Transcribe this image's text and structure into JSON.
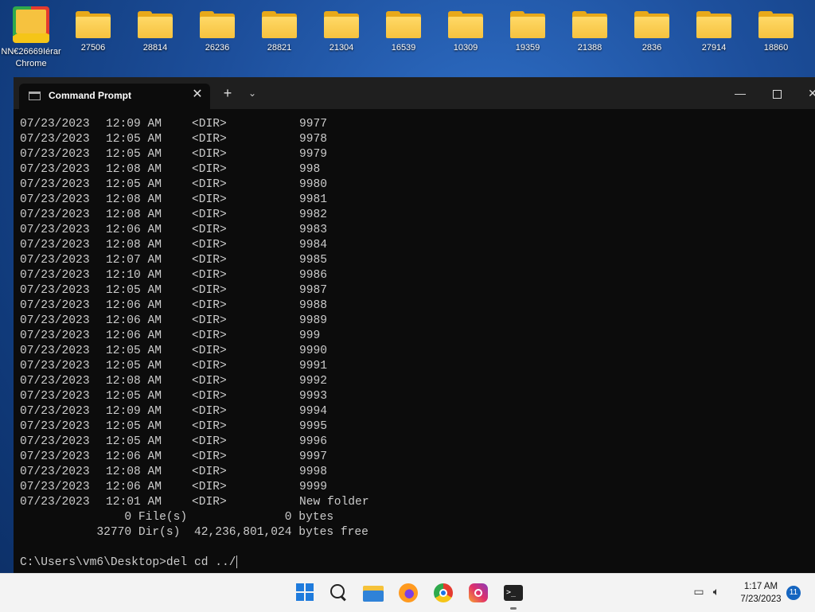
{
  "desktop": {
    "chrome_shortcut": {
      "label_line1": "NN€26669Iérar",
      "label_line2": "Chrome"
    },
    "folders": [
      "27506",
      "28814",
      "26236",
      "28821",
      "21304",
      "16539",
      "10309",
      "19359",
      "21388",
      "2836",
      "27914",
      "18860"
    ]
  },
  "window": {
    "tab_title": "Command Prompt",
    "tab_close": "✕",
    "new_tab": "+",
    "tab_dropdown": "⌄",
    "minimize": "—",
    "close": "✕"
  },
  "console": {
    "rows": [
      {
        "date": "07/23/2023",
        "time": "12:09 AM",
        "type": "<DIR>",
        "name": "9977"
      },
      {
        "date": "07/23/2023",
        "time": "12:05 AM",
        "type": "<DIR>",
        "name": "9978"
      },
      {
        "date": "07/23/2023",
        "time": "12:05 AM",
        "type": "<DIR>",
        "name": "9979"
      },
      {
        "date": "07/23/2023",
        "time": "12:08 AM",
        "type": "<DIR>",
        "name": "998"
      },
      {
        "date": "07/23/2023",
        "time": "12:05 AM",
        "type": "<DIR>",
        "name": "9980"
      },
      {
        "date": "07/23/2023",
        "time": "12:08 AM",
        "type": "<DIR>",
        "name": "9981"
      },
      {
        "date": "07/23/2023",
        "time": "12:08 AM",
        "type": "<DIR>",
        "name": "9982"
      },
      {
        "date": "07/23/2023",
        "time": "12:06 AM",
        "type": "<DIR>",
        "name": "9983"
      },
      {
        "date": "07/23/2023",
        "time": "12:08 AM",
        "type": "<DIR>",
        "name": "9984"
      },
      {
        "date": "07/23/2023",
        "time": "12:07 AM",
        "type": "<DIR>",
        "name": "9985"
      },
      {
        "date": "07/23/2023",
        "time": "12:10 AM",
        "type": "<DIR>",
        "name": "9986"
      },
      {
        "date": "07/23/2023",
        "time": "12:05 AM",
        "type": "<DIR>",
        "name": "9987"
      },
      {
        "date": "07/23/2023",
        "time": "12:06 AM",
        "type": "<DIR>",
        "name": "9988"
      },
      {
        "date": "07/23/2023",
        "time": "12:06 AM",
        "type": "<DIR>",
        "name": "9989"
      },
      {
        "date": "07/23/2023",
        "time": "12:06 AM",
        "type": "<DIR>",
        "name": "999"
      },
      {
        "date": "07/23/2023",
        "time": "12:05 AM",
        "type": "<DIR>",
        "name": "9990"
      },
      {
        "date": "07/23/2023",
        "time": "12:05 AM",
        "type": "<DIR>",
        "name": "9991"
      },
      {
        "date": "07/23/2023",
        "time": "12:08 AM",
        "type": "<DIR>",
        "name": "9992"
      },
      {
        "date": "07/23/2023",
        "time": "12:05 AM",
        "type": "<DIR>",
        "name": "9993"
      },
      {
        "date": "07/23/2023",
        "time": "12:09 AM",
        "type": "<DIR>",
        "name": "9994"
      },
      {
        "date": "07/23/2023",
        "time": "12:05 AM",
        "type": "<DIR>",
        "name": "9995"
      },
      {
        "date": "07/23/2023",
        "time": "12:05 AM",
        "type": "<DIR>",
        "name": "9996"
      },
      {
        "date": "07/23/2023",
        "time": "12:06 AM",
        "type": "<DIR>",
        "name": "9997"
      },
      {
        "date": "07/23/2023",
        "time": "12:08 AM",
        "type": "<DIR>",
        "name": "9998"
      },
      {
        "date": "07/23/2023",
        "time": "12:06 AM",
        "type": "<DIR>",
        "name": "9999"
      },
      {
        "date": "07/23/2023",
        "time": "12:01 AM",
        "type": "<DIR>",
        "name": "New folder"
      }
    ],
    "files_summary": "               0 File(s)              0 bytes",
    "dirs_summary": "           32770 Dir(s)  42,236,801,024 bytes free",
    "prompt": "C:\\Users\\vm6\\Desktop>",
    "command": "del cd ../"
  },
  "taskbar": {
    "apps": [
      "start-icon",
      "search-icon",
      "file-explorer-icon",
      "firefox-icon",
      "chrome-icon",
      "instagram-icon",
      "terminal-icon"
    ],
    "time": "1:17 AM",
    "date": "7/23/2023",
    "notifications": "11"
  },
  "colors": {
    "console_bg": "#0c0c0c",
    "console_fg": "#cccccc",
    "titlebar_bg": "#1f1f1f",
    "taskbar_bg": "#f3f3f3",
    "folder_yellow": "#f6c23f",
    "accent_blue": "#1565c0"
  }
}
